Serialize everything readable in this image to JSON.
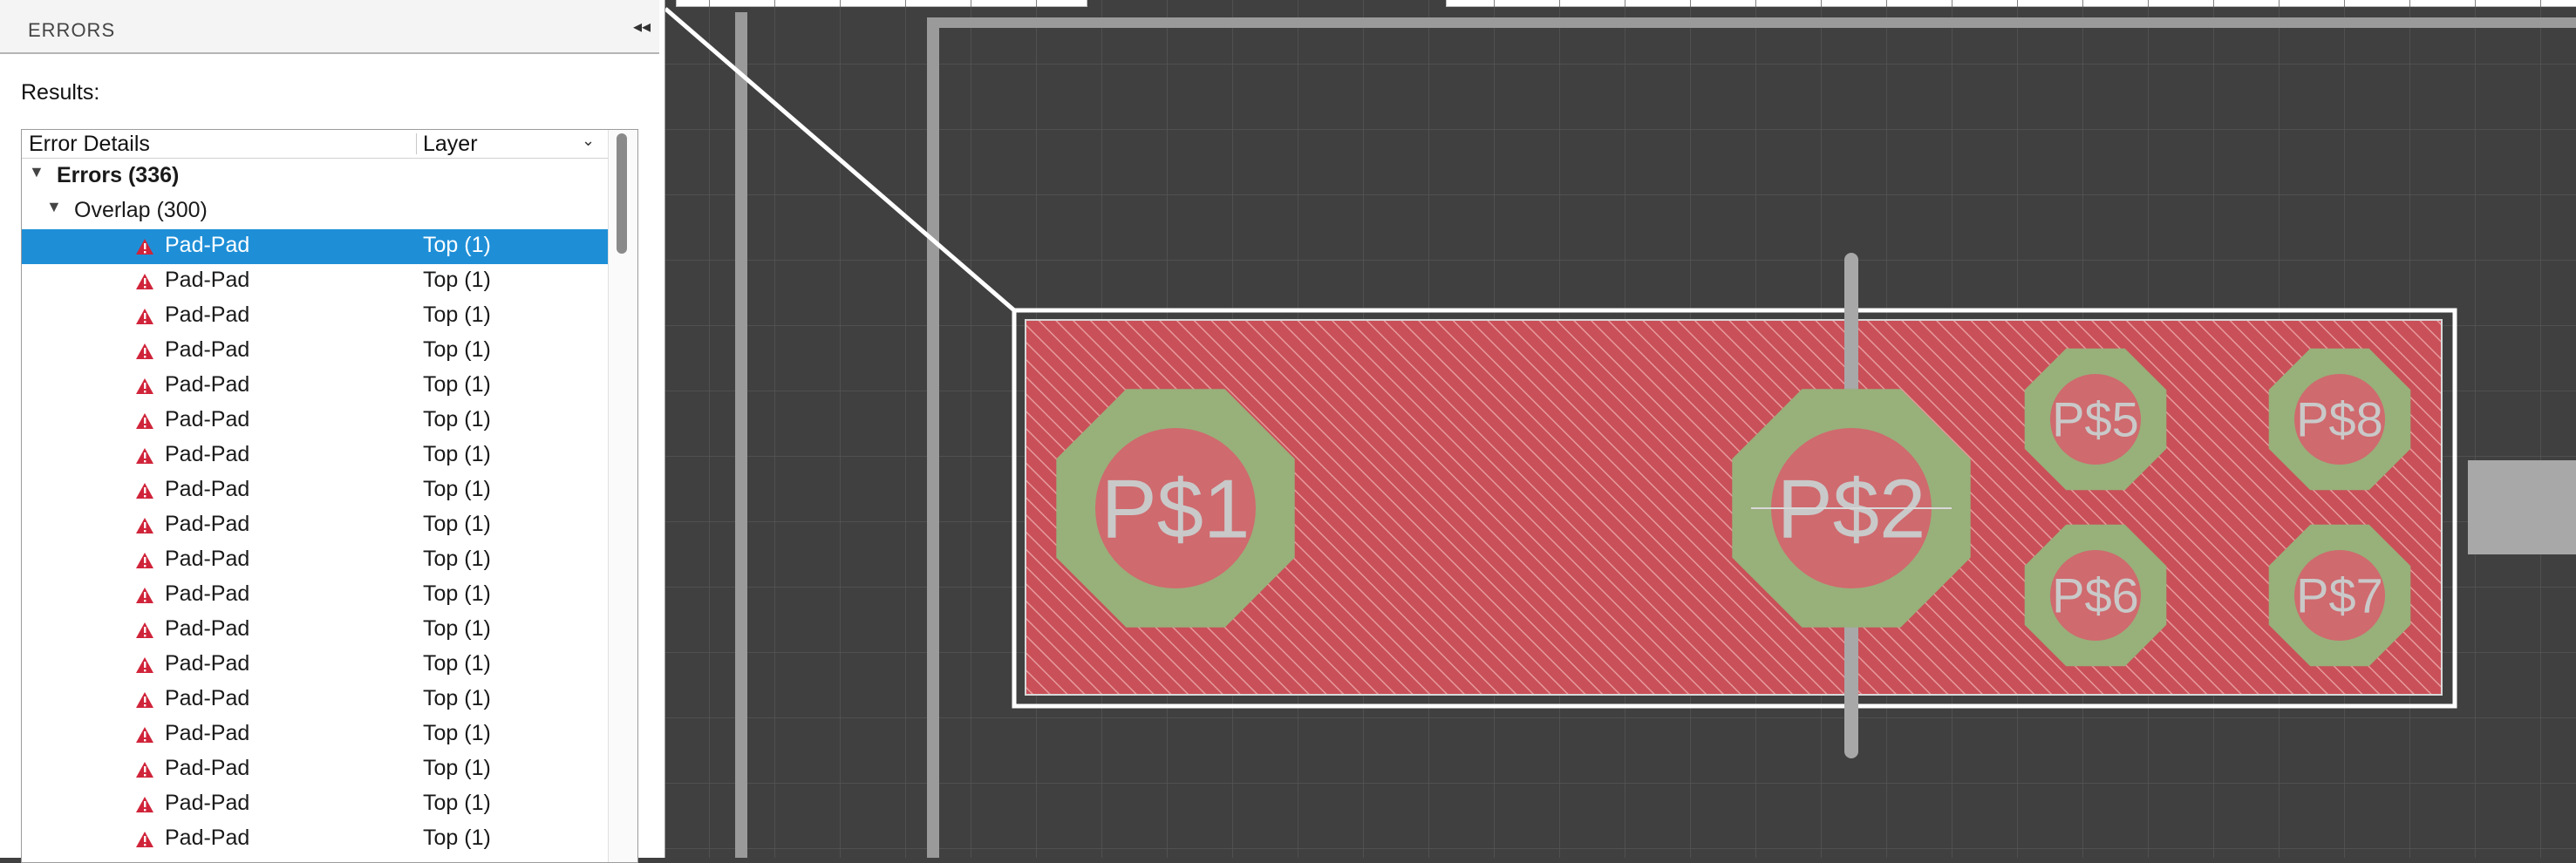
{
  "panel": {
    "title": "ERRORS",
    "collapse_glyph": "◂◂",
    "results_label": "Results:",
    "columns": {
      "details": "Error Details",
      "layer": "Layer",
      "sort_glyph": "⌄"
    }
  },
  "tree": {
    "group": {
      "label": "Errors (336)",
      "expanded": true
    },
    "subgroup": {
      "label": "Overlap (300)",
      "expanded": true
    },
    "items": [
      {
        "name": "Pad-Pad",
        "layer": "Top (1)",
        "selected": true
      },
      {
        "name": "Pad-Pad",
        "layer": "Top (1)"
      },
      {
        "name": "Pad-Pad",
        "layer": "Top (1)"
      },
      {
        "name": "Pad-Pad",
        "layer": "Top (1)"
      },
      {
        "name": "Pad-Pad",
        "layer": "Top (1)"
      },
      {
        "name": "Pad-Pad",
        "layer": "Top (1)"
      },
      {
        "name": "Pad-Pad",
        "layer": "Top (1)"
      },
      {
        "name": "Pad-Pad",
        "layer": "Top (1)"
      },
      {
        "name": "Pad-Pad",
        "layer": "Top (1)"
      },
      {
        "name": "Pad-Pad",
        "layer": "Top (1)"
      },
      {
        "name": "Pad-Pad",
        "layer": "Top (1)"
      },
      {
        "name": "Pad-Pad",
        "layer": "Top (1)"
      },
      {
        "name": "Pad-Pad",
        "layer": "Top (1)"
      },
      {
        "name": "Pad-Pad",
        "layer": "Top (1)"
      },
      {
        "name": "Pad-Pad",
        "layer": "Top (1)"
      },
      {
        "name": "Pad-Pad",
        "layer": "Top (1)"
      },
      {
        "name": "Pad-Pad",
        "layer": "Top (1)"
      },
      {
        "name": "Pad-Pad",
        "layer": "Top (1)"
      }
    ]
  },
  "board": {
    "pads": [
      {
        "label": "P$1"
      },
      {
        "label": "P$2"
      },
      {
        "label": "P$5"
      },
      {
        "label": "P$8"
      },
      {
        "label": "P$6"
      },
      {
        "label": "P$7"
      }
    ]
  },
  "colors": {
    "selection": "#1e8fd7",
    "error_fill": "#c95058",
    "pad": "#98b07a",
    "canvas_bg": "#404040",
    "grid": "#555555",
    "warning": "#d0243a"
  }
}
